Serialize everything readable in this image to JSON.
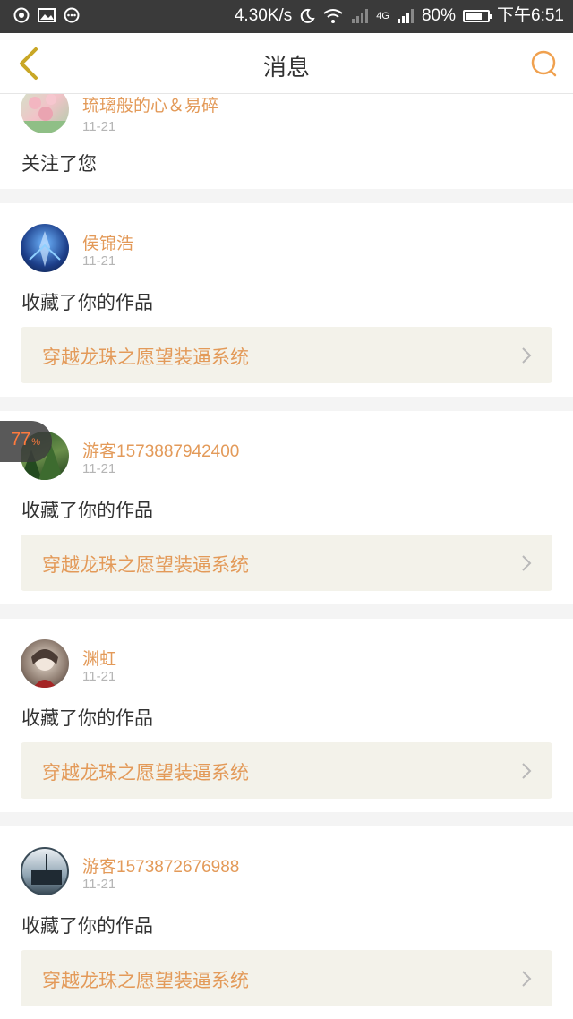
{
  "status_bar": {
    "speed": "4.30K/s",
    "network_type": "4G",
    "battery": "80%",
    "battery_level": 0.8,
    "time": "下午6:51"
  },
  "header": {
    "title": "消息",
    "back_icon": "chevron-left-icon",
    "search_icon": "search-icon"
  },
  "accent_color": "#e39a59",
  "notifications": [
    {
      "user": "琉璃般的心＆易碎",
      "date": "11-21",
      "action": "关注了您"
    },
    {
      "user": "侯锦浩",
      "date": "11-21",
      "action": "收藏了你的作品",
      "work": "穿越龙珠之愿望装逼系统"
    },
    {
      "user": "游客1573887942400",
      "date": "11-21",
      "action": "收藏了你的作品",
      "work": "穿越龙珠之愿望装逼系统"
    },
    {
      "user": "渊虹",
      "date": "11-21",
      "action": "收藏了你的作品",
      "work": "穿越龙珠之愿望装逼系统"
    },
    {
      "user": "游客1573872676988",
      "date": "11-21",
      "action": "收藏了你的作品",
      "work": "穿越龙珠之愿望装逼系统"
    }
  ],
  "floating_bubble": {
    "value": "77",
    "unit": "%"
  }
}
